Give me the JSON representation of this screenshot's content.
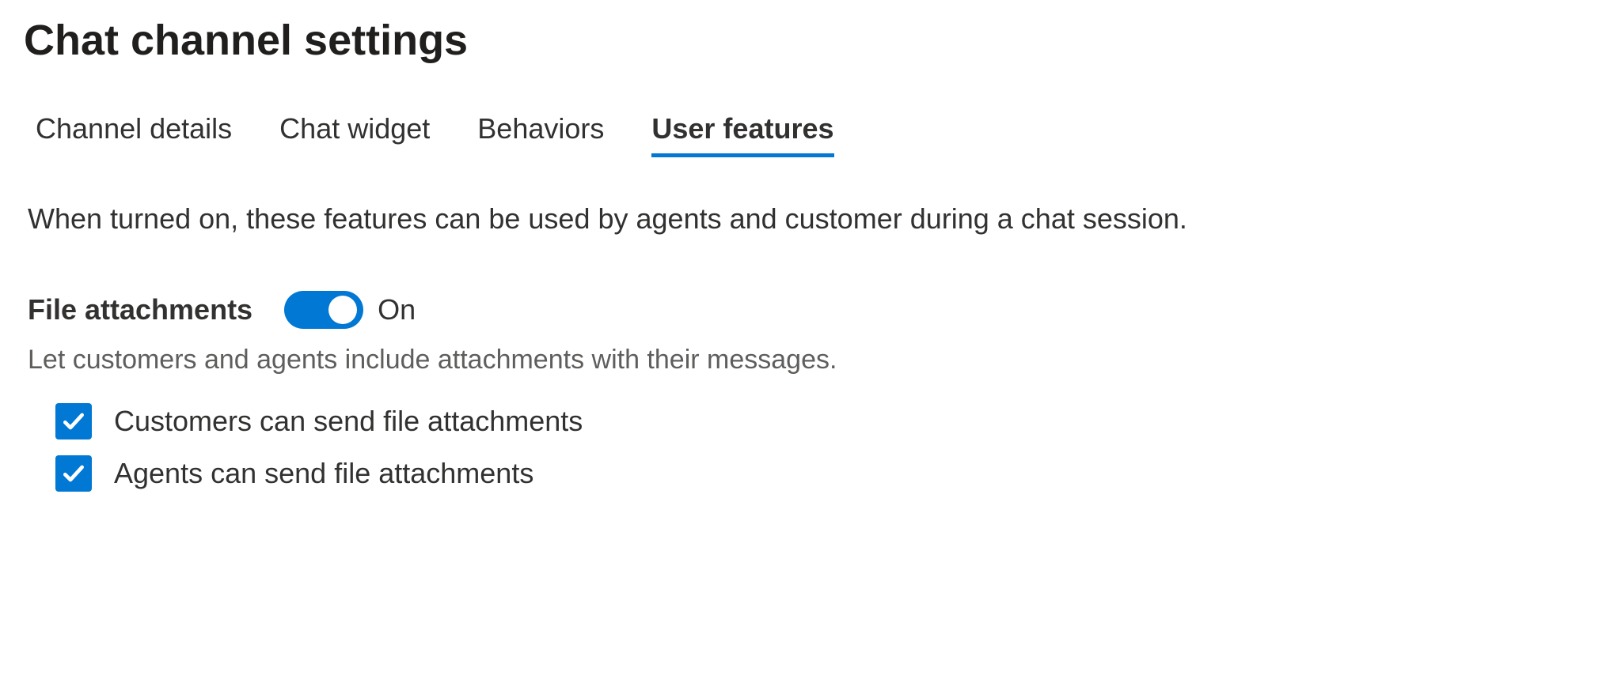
{
  "header": {
    "title": "Chat channel settings"
  },
  "tabs": [
    {
      "label": "Channel details",
      "active": false
    },
    {
      "label": "Chat widget",
      "active": false
    },
    {
      "label": "Behaviors",
      "active": false
    },
    {
      "label": "User features",
      "active": true
    }
  ],
  "main": {
    "description": "When turned on, these features can be used by agents and customer during a chat session."
  },
  "fileAttachments": {
    "label": "File attachments",
    "toggleState": "On",
    "toggleOn": true,
    "helper": "Let customers and agents include attachments with their messages.",
    "options": [
      {
        "label": "Customers can send file attachments",
        "checked": true
      },
      {
        "label": "Agents can send file attachments",
        "checked": true
      }
    ]
  }
}
